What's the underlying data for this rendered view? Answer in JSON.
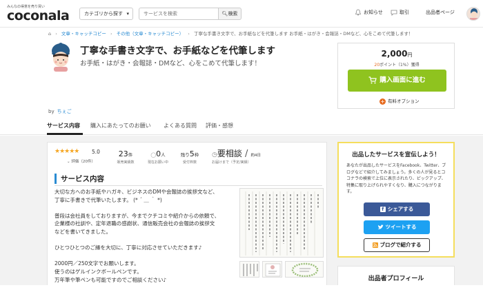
{
  "header": {
    "logo_tagline": "みんなの得意を売り買い",
    "logo_text": "coconala",
    "category_button": "カテゴリから探す",
    "search_placeholder": "サービスを検索",
    "search_button": "検索",
    "notifications": "お知らせ",
    "transactions": "取引",
    "seller_page": "出品者ページ"
  },
  "breadcrumb": {
    "items": [
      "文章・キャッチコピー",
      "その他（文章・キャッチコピー）",
      "丁寧な手書き文字で、お手紙などを代筆します お手紙・はがき・会報誌・DMなど、心をこめて代筆します！"
    ]
  },
  "service": {
    "title": "丁寧な手書き文字で、お手紙などを代筆します",
    "subtitle": "お手紙・はがき・会報誌・DMなど、心をこめて代筆します！",
    "by_label": "by",
    "seller_name": "ちぇご"
  },
  "purchase": {
    "price": "2,000",
    "price_unit": "円",
    "points_value": "20",
    "points_text": "ポイント（1%）獲得",
    "buy_button": "購入画面に進む",
    "paid_option": "有料オプション"
  },
  "tabs": [
    {
      "label": "サービス内容",
      "active": true
    },
    {
      "label": "購入にあたってのお願い",
      "active": false
    },
    {
      "label": "よくある質問",
      "active": false
    },
    {
      "label": "評価・感想",
      "active": false
    }
  ],
  "stats": {
    "rating": "5.0",
    "rating_count": "評価（20件）",
    "sales_num": "23",
    "sales_unit": "件",
    "sales_label": "販売実績数",
    "inprogress_num": "0",
    "inprogress_unit": "人",
    "inprogress_label": "現在お願い中",
    "remaining_prefix": "残り",
    "remaining_num": "5",
    "remaining_unit": "枠",
    "remaining_label": "受付枠数",
    "delivery_value": "要相談",
    "delivery_approx": "約4日",
    "delivery_label": "お届けまで（予定/実績）"
  },
  "content": {
    "section_title": "サービス内容",
    "paragraphs": [
      [
        "大切な方へのお手紙やハガキ、ビジネスのDMや会報誌の挨拶文など、",
        "丁寧に手書きで代筆いたします。 (* ´ ＿ ｀ *)"
      ],
      [
        "普段は会社員をしておりますが、今までクチコミや紹介からの依頼で、",
        "企業様の社訓や、定年退職の感謝状、通信販売会社の会報誌の挨拶文",
        "などを書いてきました。"
      ],
      [
        "ひとつひとつのご縁を大切に、丁寧に対応させていただきます♪"
      ],
      [
        "2000円／250文字でお願いします。",
        "使うのはゲルインクボールペンです。",
        "万年筆や筆ペンも可能ですのでご相談ください♪"
      ]
    ]
  },
  "promo": {
    "title": "出品したサービスを宣伝しよう！",
    "text": "あなたが出品したサービスをFacebook、Twitter、ブログなどで紹介してみましょう。多くの人が見るとココナラの検索で上位に表示されたり、ピックアップ、特集に取り上げられやすくなり、購入につながります。",
    "facebook_button": "シェアする",
    "twitter_button": "ツイートする",
    "blog_button": "ブログで紹介する"
  },
  "profile": {
    "title": "出品者プロフィール"
  },
  "colors": {
    "accent_blue": "#2a8bd2",
    "buy_green": "#8fc31f",
    "point_orange": "#e66a1e",
    "star": "#f5a623",
    "facebook": "#3b5998",
    "twitter": "#1da1f2",
    "promo_border": "#f5de5c"
  }
}
